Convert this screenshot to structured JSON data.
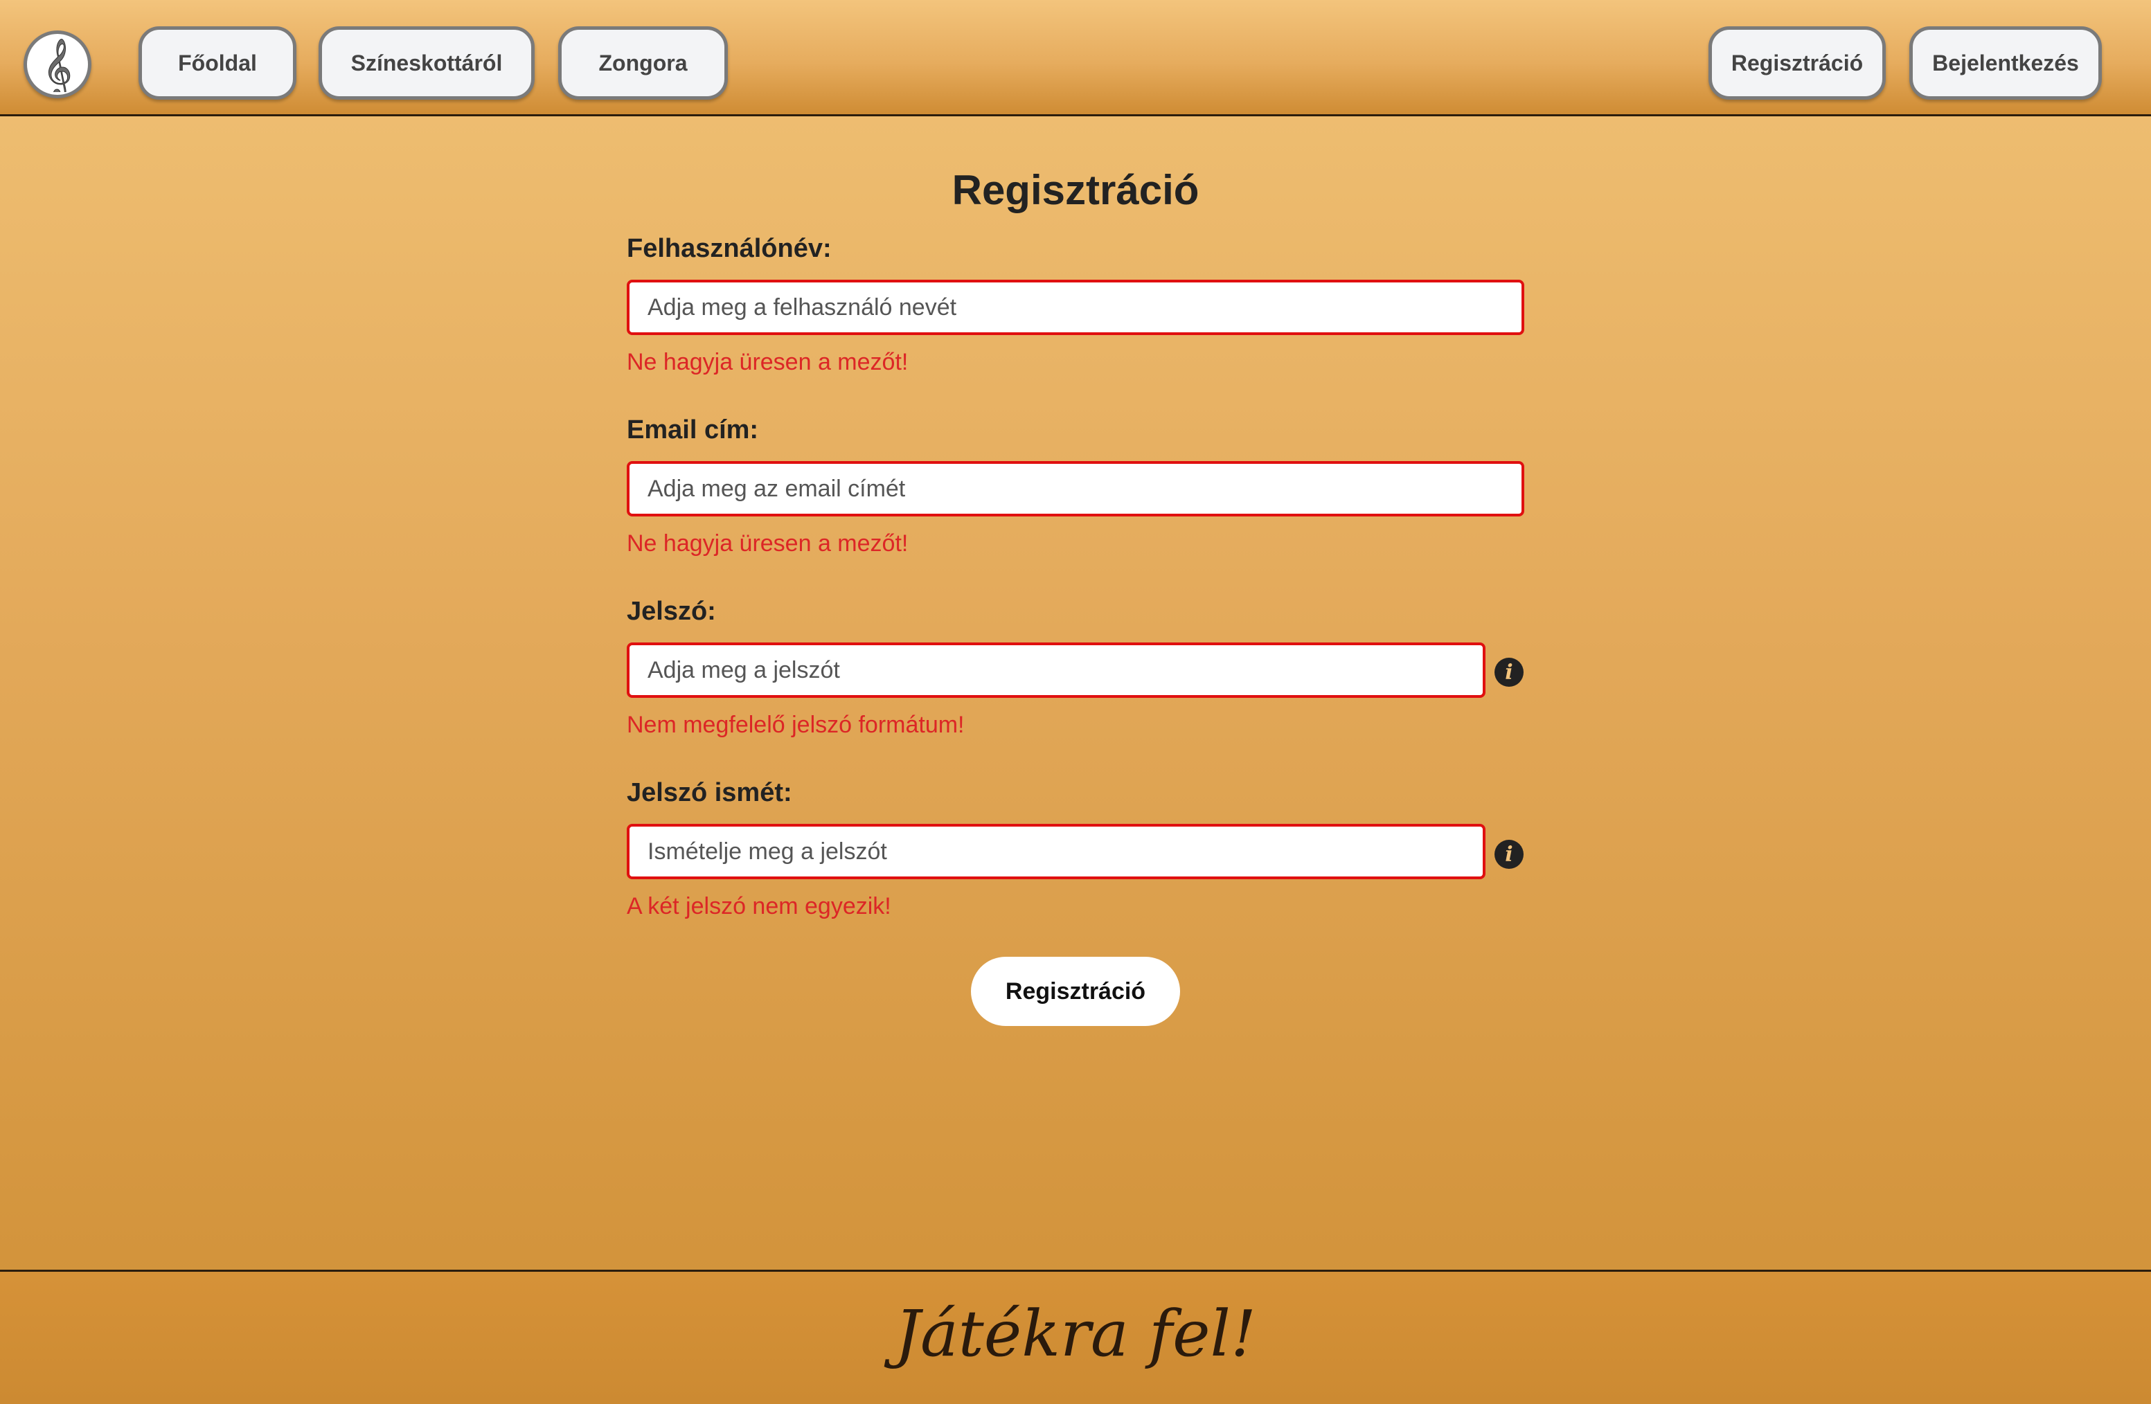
{
  "header": {
    "logo_icon": "treble-clef-icon",
    "nav_left": [
      "Főoldal",
      "Színeskottáról",
      "Zongora"
    ],
    "nav_right": [
      "Regisztráció",
      "Bejelentkezés"
    ]
  },
  "form": {
    "title": "Regisztráció",
    "fields": [
      {
        "label": "Felhasználónév:",
        "placeholder": "Adja meg a felhasználó nevét",
        "error": "Ne hagyja üresen a mezőt!"
      },
      {
        "label": "Email cím:",
        "placeholder": "Adja meg az email címét",
        "error": "Ne hagyja üresen a mezőt!"
      },
      {
        "label": "Jelszó:",
        "placeholder": "Adja meg a jelszót",
        "error": "Nem megfelelő jelszó formátum!",
        "info_icon": "info-icon"
      },
      {
        "label": "Jelszó ismét:",
        "placeholder": "Ismételje meg a jelszót",
        "error": "A két jelszó nem egyezik!",
        "info_icon": "info-icon"
      }
    ],
    "submit_label": "Regisztráció",
    "error_color": "#dc2626",
    "input_border_color": "#e01010"
  },
  "footer": {
    "text": "Játékra fel!"
  }
}
